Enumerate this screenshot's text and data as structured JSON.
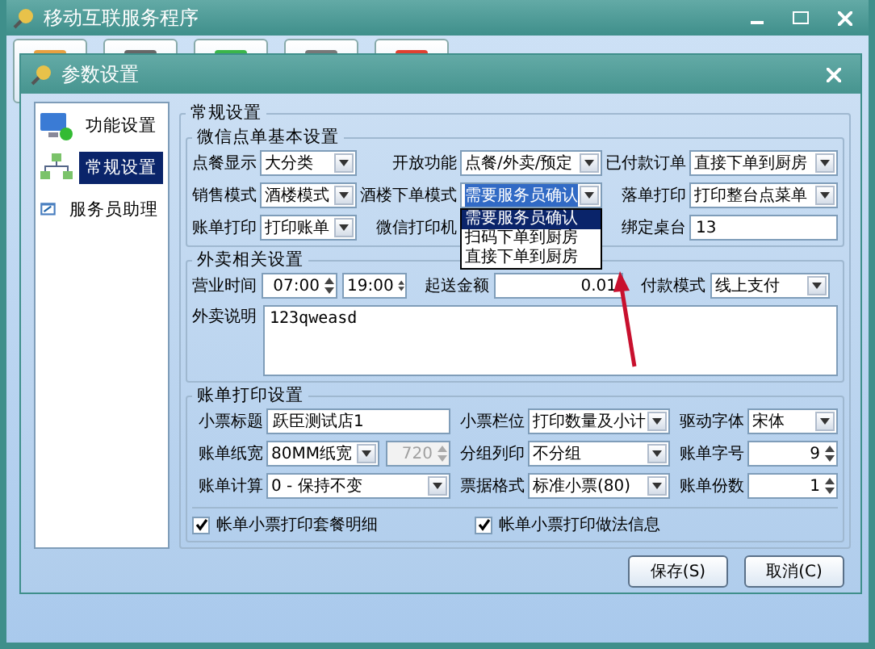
{
  "window": {
    "title": "移动互联服务程序"
  },
  "dialog": {
    "title": "参数设置"
  },
  "sidebar": {
    "items": [
      {
        "label": "功能设置",
        "selected": false
      },
      {
        "label": "常规设置",
        "selected": true
      },
      {
        "label": "服务员助理",
        "selected": false
      }
    ]
  },
  "general": {
    "title": "常规设置",
    "wechat": {
      "title": "微信点单基本设置",
      "fields": [
        {
          "label": "点餐显示",
          "controls": [
            {
              "kind": "select",
              "value": "大分类"
            }
          ]
        },
        {
          "label": "开放功能",
          "controls": [
            {
              "kind": "select",
              "value": "点餐/外卖/预定"
            }
          ]
        },
        {
          "label": "已付款订单",
          "controls": [
            {
              "kind": "select",
              "value": "直接下单到厨房"
            }
          ]
        },
        {
          "label": "销售模式",
          "controls": [
            {
              "kind": "select",
              "value": "酒楼模式"
            }
          ]
        },
        {
          "label": "酒楼下单模式",
          "controls": [
            {
              "kind": "select",
              "value": "需要服务员确认",
              "options": [
                {
                  "label": "需要服务员确认",
                  "selected": true
                },
                {
                  "label": "扫码下单到厨房",
                  "selected": false
                },
                {
                  "label": "直接下单到厨房",
                  "selected": false
                }
              ]
            }
          ]
        },
        {
          "label": "落单打印",
          "controls": [
            {
              "kind": "select",
              "value": "打印整台点菜单"
            }
          ]
        },
        {
          "label": "账单打印",
          "controls": [
            {
              "kind": "select",
              "value": "打印账单"
            }
          ]
        },
        {
          "label": "微信打印机"
        },
        {
          "label": "绑定桌台",
          "controls": [
            {
              "kind": "text",
              "value": "13"
            }
          ]
        }
      ]
    },
    "takeout": {
      "title": "外卖相关设置",
      "fields": [
        {
          "label": "营业时间",
          "controls": [
            {
              "kind": "spin",
              "value": "07:00",
              "disabled": false
            },
            {
              "kind": "spin",
              "value": "19:00",
              "disabled": false
            }
          ]
        },
        {
          "label": "起送金额",
          "controls": [
            {
              "kind": "number",
              "value": "0.01"
            }
          ]
        },
        {
          "label": "付款模式",
          "controls": [
            {
              "kind": "select",
              "value": "线上支付"
            }
          ]
        }
      ],
      "note": {
        "label": "外卖说明",
        "value": "123qweasd"
      }
    },
    "billing": {
      "title": "账单打印设置",
      "fields": [
        {
          "label": "小票标题",
          "controls": [
            {
              "kind": "text",
              "value": "跃臣测试店1"
            }
          ]
        },
        {
          "label": "小票栏位",
          "controls": [
            {
              "kind": "select",
              "value": "打印数量及小计"
            }
          ]
        },
        {
          "label": "驱动字体",
          "controls": [
            {
              "kind": "select",
              "value": "宋体"
            }
          ]
        },
        {
          "label": "账单纸宽",
          "controls": [
            {
              "kind": "select",
              "value": "80MM纸宽"
            },
            {
              "kind": "spin",
              "value": "720",
              "disabled": true
            }
          ]
        },
        {
          "label": "分组列印",
          "controls": [
            {
              "kind": "select",
              "value": "不分组"
            }
          ]
        },
        {
          "label": "账单字号",
          "controls": [
            {
              "kind": "spin",
              "value": "9",
              "disabled": false
            }
          ]
        },
        {
          "label": "账单计算",
          "controls": [
            {
              "kind": "select",
              "value": "0 - 保持不变"
            }
          ]
        },
        {
          "label": "票据格式",
          "controls": [
            {
              "kind": "select",
              "value": "标准小票(80)"
            }
          ]
        },
        {
          "label": "账单份数",
          "controls": [
            {
              "kind": "spin",
              "value": "1",
              "disabled": false
            }
          ]
        }
      ],
      "checkboxes": [
        {
          "label": "帐单小票打印套餐明细",
          "checked": true
        },
        {
          "label": "帐单小票打印做法信息",
          "checked": true
        }
      ]
    }
  },
  "buttons": [
    "保存(S)",
    "取消(C)"
  ]
}
